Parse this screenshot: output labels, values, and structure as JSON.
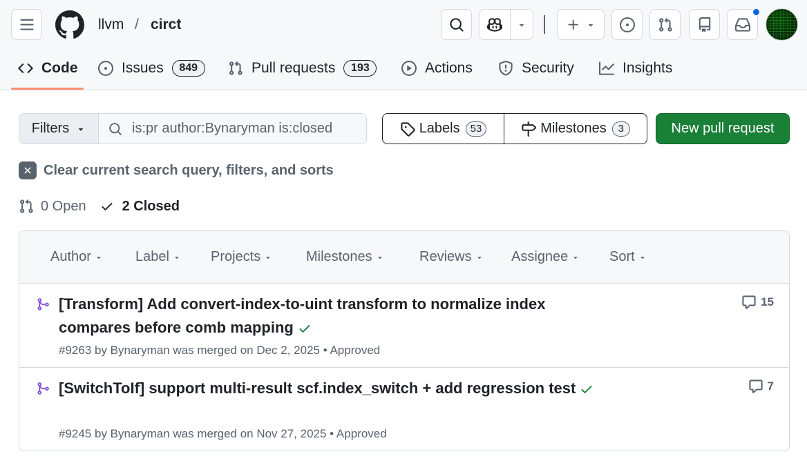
{
  "header": {
    "owner": "llvm",
    "separator": "/",
    "repo": "circt"
  },
  "tabs": [
    {
      "label": "Code"
    },
    {
      "label": "Issues",
      "count": "849"
    },
    {
      "label": "Pull requests",
      "count": "193"
    },
    {
      "label": "Actions"
    },
    {
      "label": "Security"
    },
    {
      "label": "Insights"
    }
  ],
  "filters": {
    "button_label": "Filters",
    "query": "is:pr author:Bynaryman is:closed"
  },
  "labels": {
    "label": "Labels",
    "count": "53"
  },
  "milestones": {
    "label": "Milestones",
    "count": "3"
  },
  "new_pr_label": "New pull request",
  "clear_text": "Clear current search query, filters, and sorts",
  "states": {
    "open": "0 Open",
    "closed": "2 Closed"
  },
  "list_filters": [
    "Author",
    "Label",
    "Projects",
    "Milestones",
    "Reviews",
    "Assignee",
    "Sort"
  ],
  "pull_requests": [
    {
      "title": "[Transform] Add convert-index-to-uint transform to normalize index compares before comb mapping",
      "meta": "#9263 by Bynaryman was merged on Dec 2, 2025 • Approved",
      "comments": "15"
    },
    {
      "title": "[SwitchToIf] support multi-result scf.index_switch + add regression test",
      "meta": "#9245 by Bynaryman was merged on Nov 27, 2025 • Approved",
      "comments": "7"
    }
  ],
  "colors": {
    "accent_underline": "#fd8c73",
    "merged_purple": "#8250df",
    "success_green": "#1a7f37",
    "notification_blue": "#0969da"
  }
}
